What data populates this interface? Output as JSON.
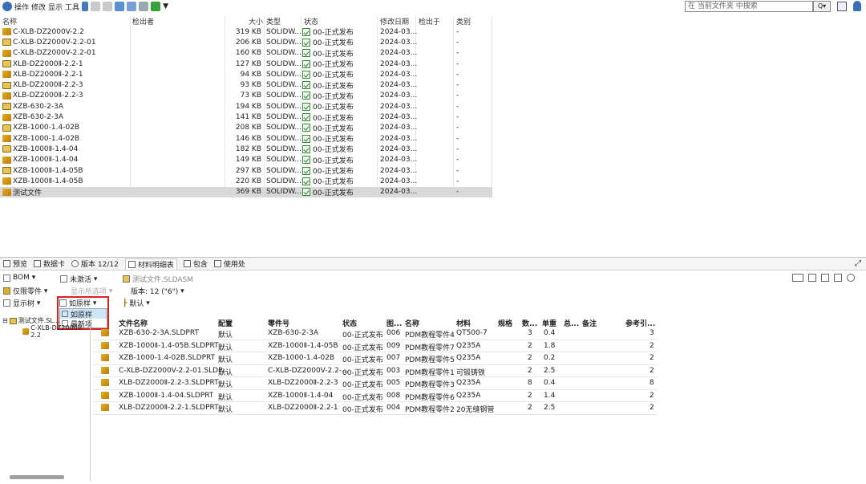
{
  "toolbar": {
    "menus": [
      "操作",
      "修改",
      "显示",
      "工具"
    ],
    "search_placeholder": "在 当前文件夹 中搜索",
    "search_btn": "Q▾"
  },
  "list": {
    "headers": {
      "name": "名称",
      "checked_out_by": "检出者",
      "size": "大小",
      "type": "类型",
      "state": "状态",
      "modified": "修改日期",
      "checked_out_in": "检出于",
      "category": "类别"
    },
    "rows": [
      {
        "name": "C-XLB-DZ2000V-2.2",
        "size": "319 KB",
        "type": "SOLIDW...",
        "state": "00-正式发布",
        "date": "2024-03...",
        "cat": "-",
        "icon": "part"
      },
      {
        "name": "C-XLB-DZ2000V-2.2-01",
        "size": "206 KB",
        "type": "SOLIDW...",
        "state": "00-正式发布",
        "date": "2024-03...",
        "cat": "-",
        "icon": "asm"
      },
      {
        "name": "C-XLB-DZ2000V-2.2-01",
        "size": "160 KB",
        "type": "SOLIDW...",
        "state": "00-正式发布",
        "date": "2024-03...",
        "cat": "-",
        "icon": "part"
      },
      {
        "name": "XLB-DZ2000Ⅱ-2.2-1",
        "size": "127 KB",
        "type": "SOLIDW...",
        "state": "00-正式发布",
        "date": "2024-03...",
        "cat": "-",
        "icon": "asm"
      },
      {
        "name": "XLB-DZ2000Ⅱ-2.2-1",
        "size": "94 KB",
        "type": "SOLIDW...",
        "state": "00-正式发布",
        "date": "2024-03...",
        "cat": "-",
        "icon": "part"
      },
      {
        "name": "XLB-DZ2000Ⅱ-2.2-3",
        "size": "93 KB",
        "type": "SOLIDW...",
        "state": "00-正式发布",
        "date": "2024-03...",
        "cat": "-",
        "icon": "asm"
      },
      {
        "name": "XLB-DZ2000Ⅱ-2.2-3",
        "size": "73 KB",
        "type": "SOLIDW...",
        "state": "00-正式发布",
        "date": "2024-03...",
        "cat": "-",
        "icon": "part"
      },
      {
        "name": "XZB-630-2-3A",
        "size": "194 KB",
        "type": "SOLIDW...",
        "state": "00-正式发布",
        "date": "2024-03...",
        "cat": "-",
        "icon": "asm"
      },
      {
        "name": "XZB-630-2-3A",
        "size": "141 KB",
        "type": "SOLIDW...",
        "state": "00-正式发布",
        "date": "2024-03...",
        "cat": "-",
        "icon": "part"
      },
      {
        "name": "XZB-1000-1.4-02B",
        "size": "208 KB",
        "type": "SOLIDW...",
        "state": "00-正式发布",
        "date": "2024-03...",
        "cat": "-",
        "icon": "asm"
      },
      {
        "name": "XZB-1000-1.4-02B",
        "size": "146 KB",
        "type": "SOLIDW...",
        "state": "00-正式发布",
        "date": "2024-03...",
        "cat": "-",
        "icon": "part"
      },
      {
        "name": "XZB-1000Ⅱ-1.4-04",
        "size": "182 KB",
        "type": "SOLIDW...",
        "state": "00-正式发布",
        "date": "2024-03...",
        "cat": "-",
        "icon": "asm"
      },
      {
        "name": "XZB-1000Ⅱ-1.4-04",
        "size": "149 KB",
        "type": "SOLIDW...",
        "state": "00-正式发布",
        "date": "2024-03...",
        "cat": "-",
        "icon": "part"
      },
      {
        "name": "XZB-1000Ⅱ-1.4-05B",
        "size": "297 KB",
        "type": "SOLIDW...",
        "state": "00-正式发布",
        "date": "2024-03...",
        "cat": "-",
        "icon": "asm"
      },
      {
        "name": "XZB-1000Ⅱ-1.4-05B",
        "size": "220 KB",
        "type": "SOLIDW...",
        "state": "00-正式发布",
        "date": "2024-03...",
        "cat": "-",
        "icon": "part"
      },
      {
        "name": "测试文件",
        "size": "369 KB",
        "type": "SOLIDW...",
        "state": "00-正式发布",
        "date": "2024-03...",
        "cat": "-",
        "icon": "part"
      }
    ]
  },
  "tabs": [
    "预览",
    "数据卡",
    "版本 12/12",
    "材料明细表",
    "包含",
    "使用处"
  ],
  "bom": {
    "type": "BOM",
    "scope": "仅限零件",
    "tree": "显示树",
    "activation": "未激活",
    "show_selected": "显示所选项",
    "asis": "如原样",
    "file": "测试文件.SLDASM",
    "version": "版本: 12 (\"6\")",
    "config": "默认",
    "menu": [
      "如原样",
      "最新项"
    ],
    "tree_root": "测试文件.SL...",
    "tree_child": "C-XLB-DZ2000V-2.2",
    "headers": [
      "文件名称",
      "配置",
      "零件号",
      "状态",
      "图...",
      "名称",
      "材料",
      "规格",
      "数...",
      "单重",
      "总...",
      "备注",
      "参考引..."
    ],
    "rows": [
      [
        "XZB-630-2-3A.SLDPRT",
        "默认",
        "XZB-630-2-3A",
        "00-正式发布",
        "006",
        "PDM教程零件4",
        "QT500-7",
        "",
        "3",
        "0.4",
        "",
        "",
        "3"
      ],
      [
        "XZB-1000Ⅱ-1.4-05B.SLDPRT",
        "默认",
        "XZB-1000Ⅱ-1.4-05B",
        "00-正式发布",
        "009",
        "PDM教程零件7",
        "Q235A",
        "",
        "2",
        "1.8",
        "",
        "",
        "2"
      ],
      [
        "XZB-1000-1.4-02B.SLDPRT",
        "默认",
        "XZB-1000-1.4-02B",
        "00-正式发布",
        "007",
        "PDM教程零件5",
        "Q235A",
        "",
        "2",
        "0.2",
        "",
        "",
        "2"
      ],
      [
        "C-XLB-DZ2000V-2.2-01.SLDP...",
        "默认",
        "C-XLB-DZ2000V-2.2-...",
        "00-正式发布",
        "003",
        "PDM教程零件1",
        "可锻铸铁",
        "",
        "2",
        "2.5",
        "",
        "",
        "2"
      ],
      [
        "XLB-DZ2000Ⅱ-2.2-3.SLDPRT",
        "默认",
        "XLB-DZ2000Ⅱ-2.2-3",
        "00-正式发布",
        "005",
        "PDM教程零件3",
        "Q235A",
        "",
        "8",
        "0.4",
        "",
        "",
        "8"
      ],
      [
        "XZB-1000Ⅱ-1.4-04.SLDPRT",
        "默认",
        "XZB-1000Ⅱ-1.4-04",
        "00-正式发布",
        "008",
        "PDM教程零件6",
        "Q235A",
        "",
        "2",
        "1.4",
        "",
        "",
        "2"
      ],
      [
        "XLB-DZ2000Ⅱ-2.2-1.SLDPRT",
        "默认",
        "XLB-DZ2000Ⅱ-2.2-1",
        "00-正式发布",
        "004",
        "PDM教程零件2",
        "20无缝钢管",
        "",
        "2",
        "2.5",
        "",
        "",
        "2"
      ]
    ]
  }
}
